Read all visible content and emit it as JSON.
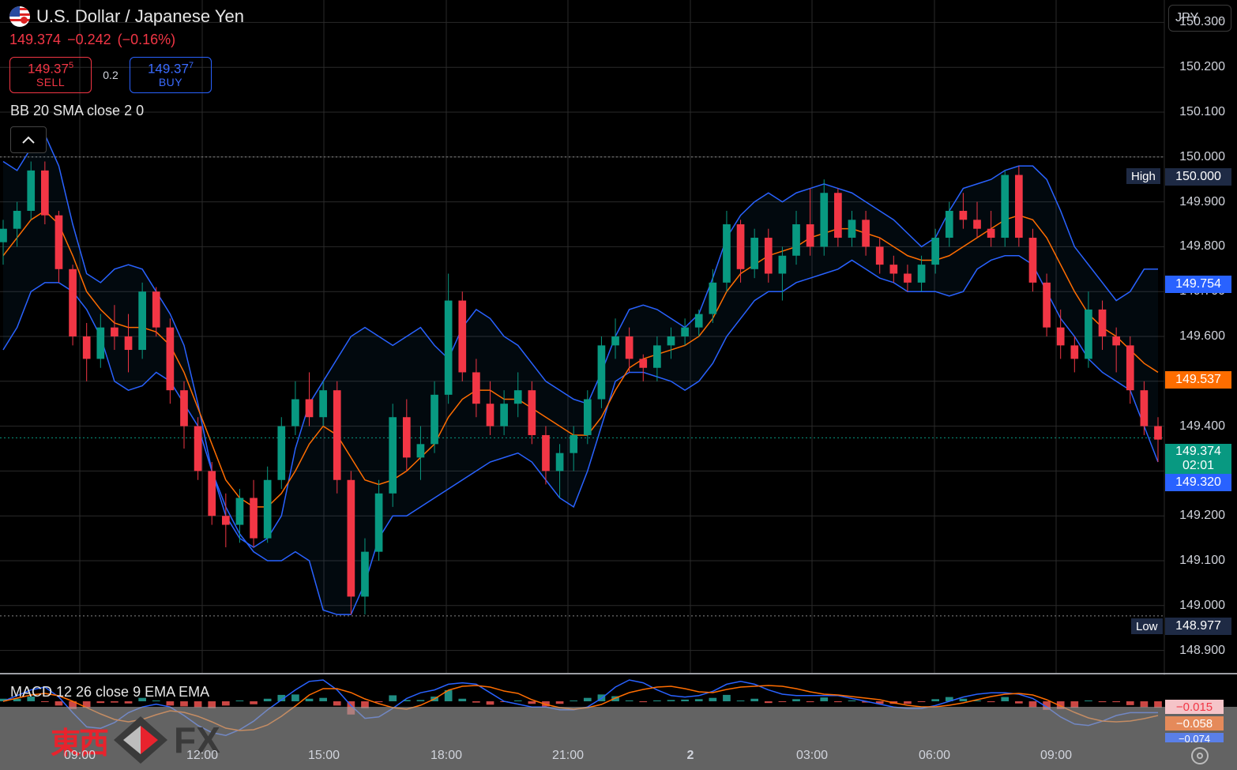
{
  "instrument": {
    "title": "U.S. Dollar / Japanese Yen",
    "last": "149.374",
    "change": "−0.242",
    "change_pct": "(−0.16%)"
  },
  "trade": {
    "sell_price": "149.37",
    "sell_sup": "5",
    "sell_label": "SELL",
    "buy_price": "149.37",
    "buy_sup": "7",
    "buy_label": "BUY",
    "spread": "0.2"
  },
  "indicators": {
    "bb_label": "BB 20 SMA close 2 0",
    "macd_label": "MACD 12 26 close 9 EMA EMA"
  },
  "currency_select": "JPY",
  "price_axis": [
    "150.300",
    "150.200",
    "150.100",
    "150.000",
    "149.900",
    "149.800",
    "149.700",
    "149.600",
    "149.500",
    "149.400",
    "149.300",
    "149.200",
    "149.100",
    "149.000",
    "148.900"
  ],
  "price_labels": {
    "high_tag": "High",
    "high": "150.000",
    "upper_band": "149.754",
    "basis": "149.537",
    "last": "149.374",
    "countdown": "02:01",
    "lower_band": "149.320",
    "low_tag": "Low",
    "low": "148.977"
  },
  "macd_values": [
    "−0.015",
    "−0.058",
    "−0.074"
  ],
  "time_axis": [
    "09:00",
    "12:00",
    "15:00",
    "18:00",
    "21:00",
    "2",
    "03:00",
    "06:00",
    "09:00"
  ],
  "watermark": {
    "kanji": "東西",
    "fx": "FX"
  },
  "colors": {
    "up": "#089981",
    "down": "#f23645",
    "bb_band": "#2962ff",
    "bb_basis": "#ff6d00",
    "sell": "#f23645",
    "buy": "#2962ff",
    "macd_line": "#2962ff",
    "signal_line": "#ff6d00"
  },
  "chart_data": {
    "type": "candlestick",
    "y_range": [
      148.85,
      150.35
    ],
    "candles": [
      [
        149.81,
        149.86,
        149.76,
        149.84
      ],
      [
        149.84,
        149.9,
        149.8,
        149.88
      ],
      [
        149.88,
        149.99,
        149.86,
        149.97
      ],
      [
        149.97,
        149.99,
        149.85,
        149.87
      ],
      [
        149.87,
        149.88,
        149.72,
        149.75
      ],
      [
        149.75,
        149.76,
        149.58,
        149.6
      ],
      [
        149.6,
        149.63,
        149.5,
        149.55
      ],
      [
        149.55,
        149.65,
        149.53,
        149.62
      ],
      [
        149.62,
        149.67,
        149.57,
        149.6
      ],
      [
        149.6,
        149.65,
        149.52,
        149.57
      ],
      [
        149.57,
        149.72,
        149.55,
        149.7
      ],
      [
        149.7,
        149.71,
        149.6,
        149.62
      ],
      [
        149.62,
        149.64,
        149.45,
        149.48
      ],
      [
        149.48,
        149.5,
        149.35,
        149.4
      ],
      [
        149.4,
        149.42,
        149.28,
        149.3
      ],
      [
        149.3,
        149.32,
        149.18,
        149.2
      ],
      [
        149.2,
        149.25,
        149.13,
        149.18
      ],
      [
        149.18,
        149.26,
        149.14,
        149.24
      ],
      [
        149.24,
        149.28,
        149.13,
        149.15
      ],
      [
        149.15,
        149.31,
        149.14,
        149.28
      ],
      [
        149.28,
        149.42,
        149.26,
        149.4
      ],
      [
        149.4,
        149.5,
        149.38,
        149.46
      ],
      [
        149.46,
        149.52,
        149.4,
        149.42
      ],
      [
        149.42,
        149.5,
        149.4,
        149.48
      ],
      [
        149.48,
        149.5,
        149.25,
        149.28
      ],
      [
        149.28,
        149.3,
        148.98,
        149.02
      ],
      [
        149.02,
        149.15,
        148.98,
        149.12
      ],
      [
        149.12,
        149.28,
        149.1,
        149.25
      ],
      [
        149.25,
        149.45,
        149.22,
        149.42
      ],
      [
        149.42,
        149.46,
        149.3,
        149.33
      ],
      [
        149.33,
        149.4,
        149.28,
        149.36
      ],
      [
        149.36,
        149.5,
        149.34,
        149.47
      ],
      [
        149.47,
        149.74,
        149.45,
        149.68
      ],
      [
        149.68,
        149.7,
        149.5,
        149.52
      ],
      [
        149.52,
        149.55,
        149.42,
        149.45
      ],
      [
        149.45,
        149.5,
        149.38,
        149.4
      ],
      [
        149.4,
        149.48,
        149.38,
        149.45
      ],
      [
        149.45,
        149.52,
        149.42,
        149.48
      ],
      [
        149.48,
        149.5,
        149.36,
        149.38
      ],
      [
        149.38,
        149.4,
        149.27,
        149.3
      ],
      [
        149.3,
        149.36,
        149.24,
        149.34
      ],
      [
        149.34,
        149.4,
        149.3,
        149.38
      ],
      [
        149.38,
        149.48,
        149.36,
        149.46
      ],
      [
        149.46,
        149.6,
        149.44,
        149.58
      ],
      [
        149.58,
        149.64,
        149.55,
        149.6
      ],
      [
        149.6,
        149.62,
        149.52,
        149.55
      ],
      [
        149.55,
        149.56,
        149.5,
        149.53
      ],
      [
        149.53,
        149.6,
        149.5,
        149.58
      ],
      [
        149.58,
        149.62,
        149.55,
        149.6
      ],
      [
        149.6,
        149.64,
        149.58,
        149.62
      ],
      [
        149.62,
        149.66,
        149.6,
        149.65
      ],
      [
        149.65,
        149.75,
        149.63,
        149.72
      ],
      [
        149.72,
        149.88,
        149.7,
        149.85
      ],
      [
        149.85,
        149.86,
        149.72,
        149.75
      ],
      [
        149.75,
        149.84,
        149.73,
        149.82
      ],
      [
        149.82,
        149.84,
        149.72,
        149.74
      ],
      [
        149.74,
        149.8,
        149.68,
        149.78
      ],
      [
        149.78,
        149.88,
        149.76,
        149.85
      ],
      [
        149.85,
        149.93,
        149.78,
        149.8
      ],
      [
        149.8,
        149.95,
        149.78,
        149.92
      ],
      [
        149.92,
        149.93,
        149.8,
        149.82
      ],
      [
        149.82,
        149.88,
        149.8,
        149.86
      ],
      [
        149.86,
        149.88,
        149.78,
        149.8
      ],
      [
        149.8,
        149.82,
        149.74,
        149.76
      ],
      [
        149.76,
        149.78,
        149.72,
        149.74
      ],
      [
        149.74,
        149.76,
        149.7,
        149.72
      ],
      [
        149.72,
        149.78,
        149.7,
        149.76
      ],
      [
        149.76,
        149.84,
        149.74,
        149.82
      ],
      [
        149.82,
        149.9,
        149.8,
        149.88
      ],
      [
        149.88,
        149.92,
        149.84,
        149.86
      ],
      [
        149.86,
        149.9,
        149.82,
        149.84
      ],
      [
        149.84,
        149.88,
        149.8,
        149.82
      ],
      [
        149.82,
        149.97,
        149.8,
        149.96
      ],
      [
        149.96,
        149.98,
        149.8,
        149.82
      ],
      [
        149.82,
        149.84,
        149.7,
        149.72
      ],
      [
        149.72,
        149.74,
        149.6,
        149.62
      ],
      [
        149.62,
        149.66,
        149.55,
        149.58
      ],
      [
        149.58,
        149.6,
        149.52,
        149.55
      ],
      [
        149.55,
        149.7,
        149.53,
        149.66
      ],
      [
        149.66,
        149.68,
        149.57,
        149.6
      ],
      [
        149.6,
        149.62,
        149.52,
        149.58
      ],
      [
        149.58,
        149.6,
        149.45,
        149.48
      ],
      [
        149.48,
        149.5,
        149.38,
        149.4
      ],
      [
        149.4,
        149.42,
        149.32,
        149.37
      ]
    ],
    "bb_upper": [
      149.99,
      149.97,
      150.02,
      150.05,
      149.98,
      149.85,
      149.74,
      149.72,
      149.75,
      149.76,
      149.75,
      149.7,
      149.65,
      149.58,
      149.45,
      149.3,
      149.2,
      149.15,
      149.13,
      149.15,
      149.2,
      149.35,
      149.45,
      149.5,
      149.55,
      149.6,
      149.62,
      149.6,
      149.58,
      149.6,
      149.62,
      149.58,
      149.55,
      149.62,
      149.66,
      149.64,
      149.6,
      149.58,
      149.54,
      149.5,
      149.48,
      149.46,
      149.45,
      149.52,
      149.6,
      149.66,
      149.67,
      149.66,
      149.64,
      149.62,
      149.65,
      149.73,
      149.82,
      149.87,
      149.9,
      149.92,
      149.9,
      149.92,
      149.93,
      149.94,
      149.93,
      149.92,
      149.9,
      149.88,
      149.86,
      149.83,
      149.8,
      149.82,
      149.88,
      149.93,
      149.94,
      149.95,
      149.97,
      149.98,
      149.98,
      149.95,
      149.88,
      149.8,
      149.76,
      149.72,
      149.68,
      149.7,
      149.75,
      149.75
    ],
    "bb_basis": [
      149.78,
      149.82,
      149.86,
      149.88,
      149.85,
      149.78,
      149.7,
      149.66,
      149.63,
      149.62,
      149.62,
      149.61,
      149.58,
      149.52,
      149.44,
      149.36,
      149.28,
      149.24,
      149.22,
      149.22,
      149.25,
      149.3,
      149.36,
      149.4,
      149.38,
      149.33,
      149.28,
      149.27,
      149.28,
      149.3,
      149.33,
      149.36,
      149.42,
      149.46,
      149.48,
      149.48,
      149.46,
      149.46,
      149.44,
      149.42,
      149.4,
      149.38,
      149.38,
      149.42,
      149.48,
      149.53,
      149.55,
      149.56,
      149.57,
      149.58,
      149.6,
      149.64,
      149.7,
      149.74,
      149.76,
      149.78,
      149.79,
      149.8,
      149.82,
      149.83,
      149.84,
      149.84,
      149.83,
      149.82,
      149.8,
      149.78,
      149.77,
      149.77,
      149.78,
      149.8,
      149.82,
      149.84,
      149.86,
      149.87,
      149.86,
      149.82,
      149.76,
      149.7,
      149.65,
      149.62,
      149.6,
      149.57,
      149.54,
      149.52
    ],
    "bb_lower": [
      149.57,
      149.62,
      149.7,
      149.72,
      149.72,
      149.7,
      149.66,
      149.6,
      149.5,
      149.48,
      149.49,
      149.52,
      149.5,
      149.45,
      149.4,
      149.3,
      149.22,
      149.16,
      149.12,
      149.1,
      149.1,
      149.12,
      149.1,
      148.99,
      148.98,
      148.98,
      149.05,
      149.15,
      149.2,
      149.2,
      149.22,
      149.24,
      149.26,
      149.28,
      149.3,
      149.32,
      149.33,
      149.34,
      149.32,
      149.28,
      149.24,
      149.22,
      149.3,
      149.4,
      149.5,
      149.52,
      149.52,
      149.51,
      149.5,
      149.48,
      149.5,
      149.54,
      149.6,
      149.64,
      149.68,
      149.7,
      149.7,
      149.72,
      149.73,
      149.74,
      149.75,
      149.77,
      149.75,
      149.73,
      149.72,
      149.7,
      149.7,
      149.7,
      149.69,
      149.7,
      149.75,
      149.77,
      149.78,
      149.78,
      149.76,
      149.7,
      149.64,
      149.6,
      149.55,
      149.52,
      149.5,
      149.48,
      149.4,
      149.32
    ]
  }
}
